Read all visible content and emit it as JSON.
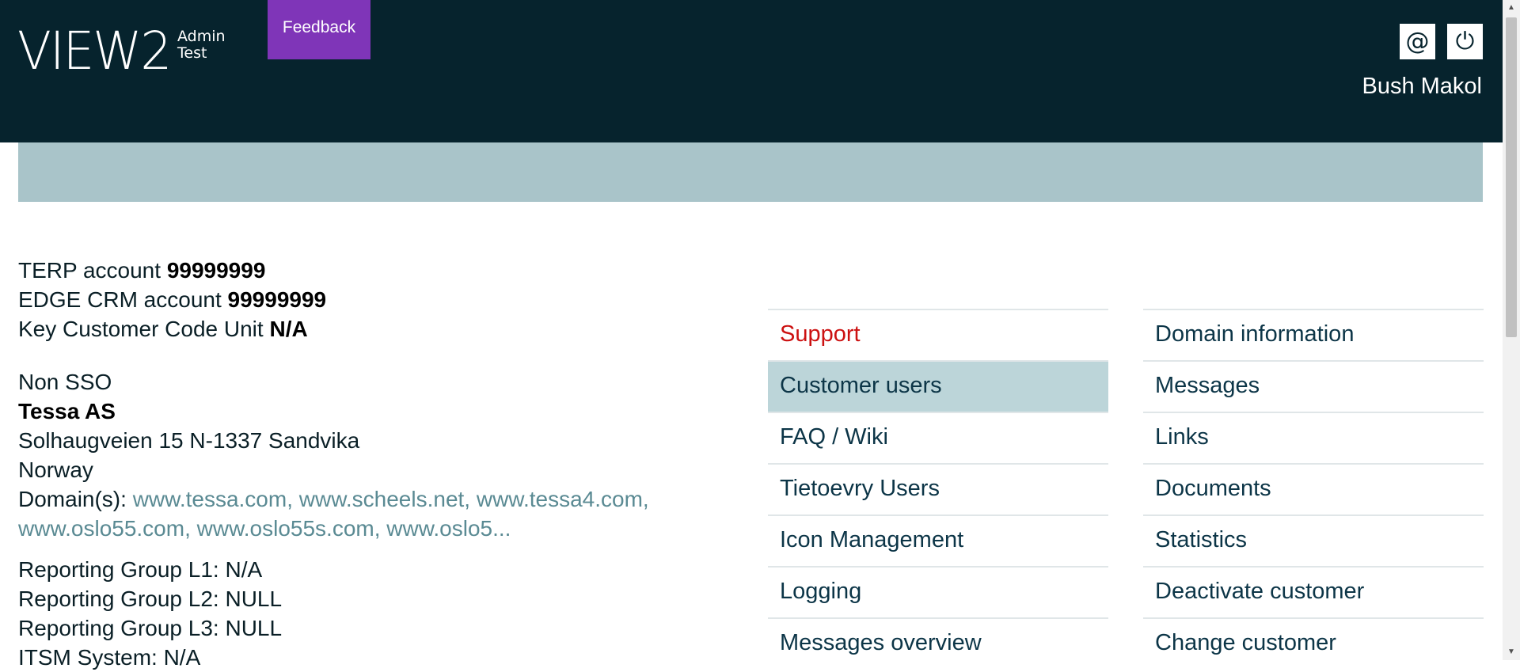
{
  "header": {
    "logo_main": "VIEW2",
    "logo_sub_line1": "Admin",
    "logo_sub_line2": "Test",
    "feedback_label": "Feedback",
    "email_icon": "@",
    "power_icon": "⏻",
    "username": "Bush Makol"
  },
  "colors": {
    "header_bg": "#06232d",
    "feedback_bg": "#7f35b8",
    "banner_bg": "#a9c4c9",
    "active_item_bg": "#bcd5d9",
    "support_text": "#cc1111",
    "link_text": "#5a8a93"
  },
  "account": {
    "terp_label": "TERP account",
    "terp_value": "99999999",
    "edge_label": "EDGE CRM account",
    "edge_value": "99999999",
    "kccu_label": "Key Customer Code Unit",
    "kccu_value": "N/A"
  },
  "customer": {
    "sso": "Non SSO",
    "name": "Tessa AS",
    "address": "Solhaugveien 15 N-1337 Sandvika",
    "country": "Norway",
    "domains_label": "Domain(s):",
    "domains_line1": "www.tessa.com, www.scheels.net, www.tessa4.com,",
    "domains_line2": "www.oslo55.com, www.oslo55s.com, www.oslo5..."
  },
  "reporting": {
    "l1": "Reporting Group L1: N/A",
    "l2": "Reporting Group L2: NULL",
    "l3": "Reporting Group L3: NULL",
    "itsm": "ITSM System: N/A"
  },
  "menu_left": [
    "Support",
    "Customer users",
    "FAQ / Wiki",
    "Tietoevry Users",
    "Icon Management",
    "Logging",
    "Messages overview"
  ],
  "menu_right": [
    "Domain information",
    "Messages",
    "Links",
    "Documents",
    "Statistics",
    "Deactivate customer",
    "Change customer"
  ]
}
